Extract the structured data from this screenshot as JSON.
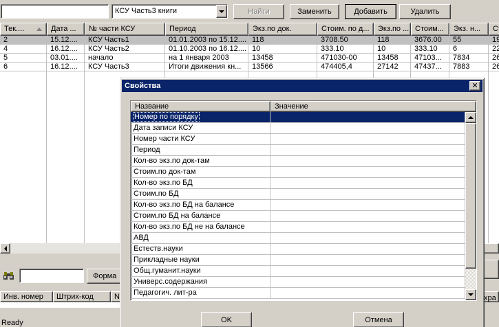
{
  "toolbar": {
    "search_value": "",
    "combo_value": "КСУ Часть3 книги",
    "find_label": "Найти",
    "replace_label": "Заменить",
    "add_label": "Добавить",
    "delete_label": "Удалить"
  },
  "grid": {
    "columns": [
      "Тек....",
      "Дата ...",
      "№ части КСУ",
      "Период",
      "Экз.по док.",
      "Стоим. по д...",
      "Экз.по ...",
      "Стоим...",
      "Экз. н...",
      "Ст"
    ],
    "rows": [
      [
        "2",
        "15.12....",
        "КСУ Часть1",
        "01.01.2003 по 15.12....",
        "118",
        "3708.50",
        "118",
        "3676.00",
        "55",
        "19"
      ],
      [
        "4",
        "16.12....",
        "КСУ Часть2",
        "01.10.2003 по 16.12....",
        "10",
        "333.10",
        "10",
        "333.10",
        "6",
        "22"
      ],
      [
        "5",
        "03.01....",
        "начало",
        "на 1 января 2003",
        "13458",
        "471030-00",
        "13458",
        "47103...",
        "7834",
        "26"
      ],
      [
        "6",
        "16.12....",
        "КСУ Часть3",
        "Итоги движения кн...",
        "13566",
        "474405,4",
        "27142",
        "47437...",
        "7883",
        "26"
      ]
    ]
  },
  "lower": {
    "search_value": "",
    "forma_label": "Форма",
    "columns": [
      "Инв. номер",
      "Штрих-код",
      "N"
    ],
    "right_header": "хра"
  },
  "status_text": "Ready",
  "dialog": {
    "title": "Свойства",
    "close_glyph": "✕",
    "col_name": "Название",
    "col_value": "Значение",
    "properties": [
      {
        "name": "Номер по порядку",
        "value": ""
      },
      {
        "name": "Дата записи КСУ",
        "value": ""
      },
      {
        "name": "Номер части КСУ",
        "value": ""
      },
      {
        "name": "Период",
        "value": ""
      },
      {
        "name": "Кол-во экз.по док-там",
        "value": ""
      },
      {
        "name": "Стоим.по док-там",
        "value": ""
      },
      {
        "name": "Кол-во экз.по БД",
        "value": ""
      },
      {
        "name": "Стоим.по БД",
        "value": ""
      },
      {
        "name": "Кол-во экз.по БД на балансе",
        "value": ""
      },
      {
        "name": "Стоим.по БД на балансе",
        "value": ""
      },
      {
        "name": "Кол-во экз.по БД не на балансе",
        "value": ""
      },
      {
        "name": "АВД",
        "value": ""
      },
      {
        "name": "Естеств.науки",
        "value": ""
      },
      {
        "name": "Прикладные науки",
        "value": ""
      },
      {
        "name": "Общ.гуманит.науки",
        "value": ""
      },
      {
        "name": "Универс.содержания",
        "value": ""
      },
      {
        "name": "Педагогич. лит-ра",
        "value": ""
      }
    ],
    "ok_label": "OK",
    "cancel_label": "Отмена"
  }
}
